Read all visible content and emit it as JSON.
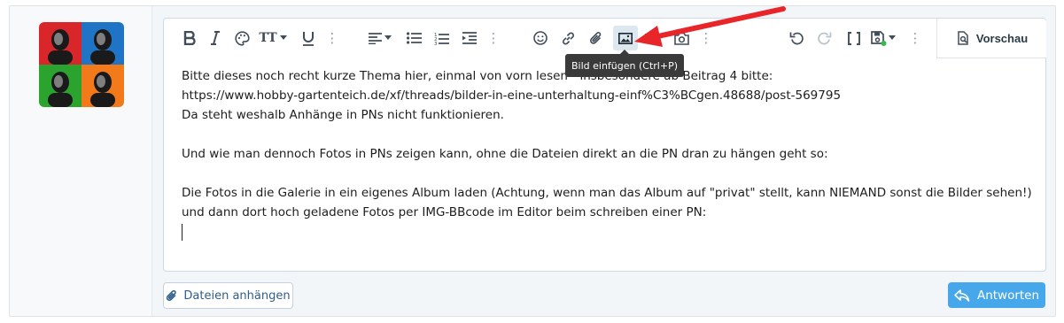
{
  "toolbar": {
    "buttons": [
      {
        "name": "bold-icon"
      },
      {
        "name": "italic-icon"
      },
      {
        "name": "palette-icon"
      },
      {
        "name": "font-size-icon"
      },
      {
        "name": "underline-icon"
      },
      {
        "name": "more-icon"
      },
      {
        "name": "align-icon"
      },
      {
        "name": "bullet-list-icon"
      },
      {
        "name": "numbered-list-icon"
      },
      {
        "name": "indent-icon"
      },
      {
        "name": "emoji-icon"
      },
      {
        "name": "link-icon"
      },
      {
        "name": "paperclip-icon"
      },
      {
        "name": "image-icon"
      },
      {
        "name": "quote-icon"
      },
      {
        "name": "camera-icon"
      },
      {
        "name": "undo-icon"
      },
      {
        "name": "redo-icon"
      },
      {
        "name": "brackets-icon"
      },
      {
        "name": "save-draft-icon"
      }
    ],
    "font_size_glyph": "TT",
    "preview_label": "Vorschau",
    "tooltip": "Bild einfügen (Ctrl+P)"
  },
  "editor": {
    "lines": [
      "Bitte dieses noch recht kurze Thema hier, einmal von vorn lesen - insbesondere ab Beitrag 4 bitte:",
      "https://www.hobby-gartenteich.de/xf/threads/bilder-in-eine-unterhaltung-einf%C3%BCgen.48688/post-569795",
      "Da steht weshalb Anhänge in PNs nicht funktionieren.",
      "",
      "Und wie man dennoch Fotos in PNs zeigen kann, ohne die Dateien direkt an die PN dran zu hängen geht so:",
      "",
      "Die Fotos in die Galerie in ein eigenes Album laden (Achtung, wenn man das Album auf \"privat\" stellt, kann NIEMAND sonst die Bilder sehen!)",
      "und dann dort hoch geladene Fotos per IMG-BBcode im Editor beim schreiben einer PN:"
    ]
  },
  "footer": {
    "attach_label": "Dateien anhängen",
    "reply_label": "Antworten"
  },
  "colors": {
    "accent": "#47a7eb",
    "arrow": "#e8262a",
    "tooltip_bg": "#3a3a3a"
  }
}
